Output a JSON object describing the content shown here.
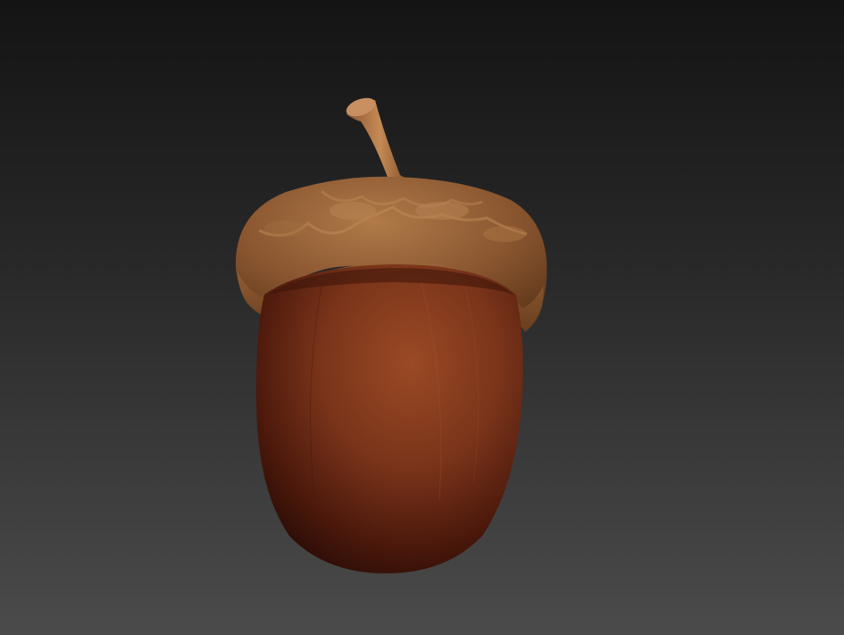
{
  "scene": {
    "subject": "acorn",
    "colors": {
      "background_top": "#141414",
      "background_bottom": "#4b4b4b",
      "nut_highlight": "#9a4a24",
      "nut_mid": "#6e2c14",
      "nut_shadow": "#2a0c06",
      "cap_light": "#a87040",
      "cap_mid": "#8a5630",
      "cap_dark": "#5a3418",
      "stem": "#b37a48"
    }
  }
}
